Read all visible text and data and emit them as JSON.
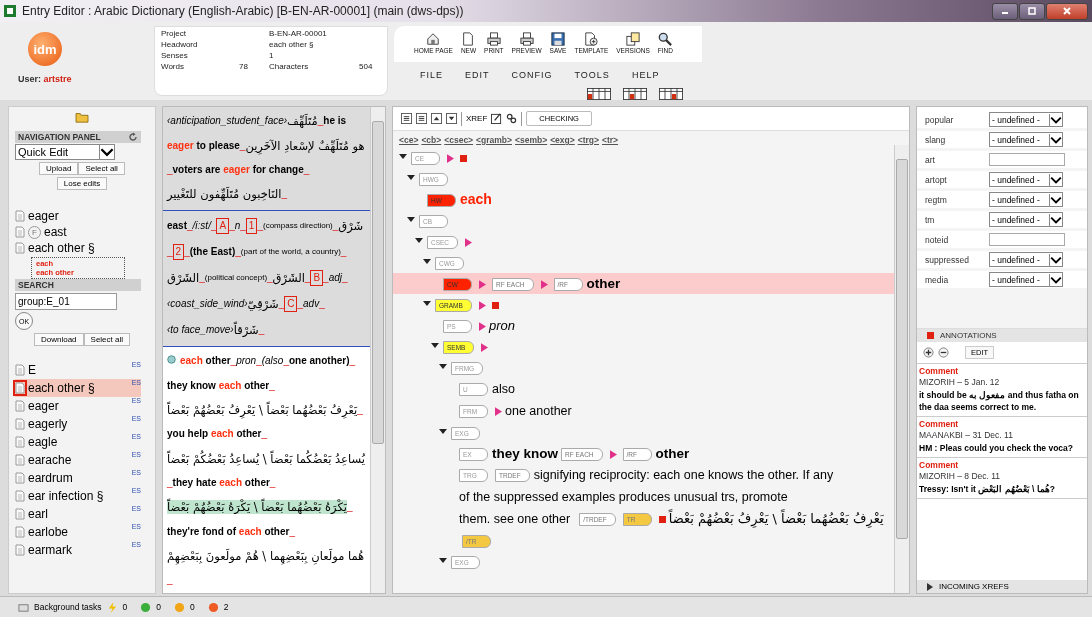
{
  "window": {
    "title": "Entry Editor : Arabic Dictionary (English-Arabic) [B-EN-AR-00001] (main (dws-dps))"
  },
  "header": {
    "logo": "idm",
    "user_label": "User:",
    "user": "artstre",
    "info": [
      {
        "label": "Project",
        "value": "B-EN-AR-00001"
      },
      {
        "label": "Headword",
        "value": "each other §"
      },
      {
        "label": "Senses",
        "value": "1"
      }
    ],
    "words_label": "Words",
    "words": "78",
    "chars_label": "Characters",
    "chars": "504"
  },
  "toolbar": [
    {
      "kind": "home",
      "label": "HOME PAGE"
    },
    {
      "kind": "new",
      "label": "NEW"
    },
    {
      "kind": "print",
      "label": "PRINT"
    },
    {
      "kind": "preview",
      "label": "PREVIEW"
    },
    {
      "kind": "save",
      "label": "SAVE"
    },
    {
      "kind": "template",
      "label": "TEMPLATE"
    },
    {
      "kind": "versions",
      "label": "VERSIONS"
    },
    {
      "kind": "find",
      "label": "FIND"
    }
  ],
  "menu": [
    "FILE",
    "EDIT",
    "CONFIG",
    "TOOLS",
    "HELP"
  ],
  "nav": {
    "title": "NAVIGATION PANEL",
    "mode": "Quick Edit",
    "buttons": [
      "Upload",
      "Select all"
    ],
    "lose": "Lose edits",
    "entries": [
      {
        "kind": "doc",
        "label": "eager"
      },
      {
        "kind": "flag",
        "badge": "F",
        "label": "east"
      },
      {
        "kind": "doc",
        "label": "each other §",
        "senses": [
          "each",
          "each other"
        ]
      }
    ]
  },
  "search": {
    "title": "SEARCH",
    "value": "group:E_01",
    "ok": "OK",
    "buttons": [
      "Download",
      "Select all"
    ],
    "results": [
      {
        "label": "E",
        "tag": "ES",
        "selected": false
      },
      {
        "label": "each other §",
        "tag": "ES",
        "selected": true
      },
      {
        "label": "eager",
        "tag": "ES",
        "selected": false
      },
      {
        "label": "eagerly",
        "tag": "ES",
        "selected": false
      },
      {
        "label": "eagle",
        "tag": "ES",
        "selected": false
      },
      {
        "label": "earache",
        "tag": "ES",
        "selected": false
      },
      {
        "label": "eardrum",
        "tag": "ES",
        "selected": false
      },
      {
        "label": "ear infection §",
        "tag": "ES",
        "selected": false
      },
      {
        "label": "earl",
        "tag": "ES",
        "selected": false
      },
      {
        "label": "earlobe",
        "tag": "ES",
        "selected": false
      },
      {
        "label": "earmark",
        "tag": "ES",
        "selected": false
      }
    ]
  },
  "preview": [
    {
      "selected": false,
      "segments": [
        {
          "kind": "it",
          "text": "‹anticipation_student_face›"
        },
        {
          "kind": "ar",
          "text": "مُتَلَهِّف"
        },
        {
          "kind": "sep",
          "text": "_"
        },
        {
          "kind": "b",
          "text": "he is "
        },
        {
          "kind": "hl",
          "text": "eager"
        },
        {
          "kind": "b",
          "text": " to please"
        },
        {
          "kind": "sep",
          "text": "_"
        },
        {
          "kind": "ar",
          "text": "هو مُتَلَهِّفٌ لإسْعادِ الآخَرِين"
        },
        {
          "kind": "sep",
          "text": "_"
        },
        {
          "kind": "b",
          "text": "voters are "
        },
        {
          "kind": "hl",
          "text": "eager"
        },
        {
          "kind": "b",
          "text": " for change"
        },
        {
          "kind": "sep",
          "text": "_"
        },
        {
          "kind": "ar",
          "text": "النَاخِبون مُتَلَهِّفون للتَغْيير"
        },
        {
          "kind": "sep",
          "text": "_"
        }
      ]
    },
    {
      "selected": false,
      "segments": [
        {
          "kind": "b",
          "text": "east"
        },
        {
          "kind": "sep",
          "text": "_"
        },
        {
          "kind": "it",
          "text": "/iːst/"
        },
        {
          "kind": "sep",
          "text": "_"
        },
        {
          "kind": "box",
          "text": "A"
        },
        {
          "kind": "sep",
          "text": "_"
        },
        {
          "kind": "it",
          "text": "n"
        },
        {
          "kind": "sep",
          "text": "_"
        },
        {
          "kind": "box",
          "text": "1"
        },
        {
          "kind": "sep",
          "text": "_"
        },
        {
          "kind": "sm",
          "text": "(compass direction)"
        },
        {
          "kind": "sep",
          "text": "_"
        },
        {
          "kind": "ar",
          "text": "شَرْق"
        },
        {
          "kind": "sep",
          "text": "_"
        },
        {
          "kind": "box",
          "text": "2"
        },
        {
          "kind": "sep",
          "text": "_"
        },
        {
          "kind": "b",
          "text": "(the East)"
        },
        {
          "kind": "sep",
          "text": "_"
        },
        {
          "kind": "sm",
          "text": "(part of the world, a country)"
        },
        {
          "kind": "sep",
          "text": "_"
        },
        {
          "kind": "ar",
          "text": "الشَرْق"
        },
        {
          "kind": "sep",
          "text": "_"
        },
        {
          "kind": "sm",
          "text": "(political concept)"
        },
        {
          "kind": "sep",
          "text": "_"
        },
        {
          "kind": "ar",
          "text": "الشَرْق"
        },
        {
          "kind": "sep",
          "text": "_"
        },
        {
          "kind": "box",
          "text": "B"
        },
        {
          "kind": "sep",
          "text": "_"
        },
        {
          "kind": "it",
          "text": "adj"
        },
        {
          "kind": "sep",
          "text": "_"
        },
        {
          "kind": "it",
          "text": "‹coast_side_wind›"
        },
        {
          "kind": "ar",
          "text": "شَرْقِيّ"
        },
        {
          "kind": "sep",
          "text": "_"
        },
        {
          "kind": "box",
          "text": "C"
        },
        {
          "kind": "sep",
          "text": "_"
        },
        {
          "kind": "it",
          "text": "adv"
        },
        {
          "kind": "sep",
          "text": "_"
        },
        {
          "kind": "it",
          "text": "‹to face_move›"
        },
        {
          "kind": "ar",
          "text": "شَرْقاً"
        },
        {
          "kind": "sep",
          "text": "_"
        }
      ]
    },
    {
      "selected": true,
      "segments": [
        {
          "kind": "hl",
          "text": "each"
        },
        {
          "kind": "b",
          "text": " other"
        },
        {
          "kind": "sep",
          "text": "_"
        },
        {
          "kind": "it",
          "text": "pron"
        },
        {
          "kind": "sep",
          "text": "_"
        },
        {
          "kind": "it",
          "text": "(also"
        },
        {
          "kind": "sep",
          "text": "_"
        },
        {
          "kind": "b",
          "text": "one another)"
        },
        {
          "kind": "sep",
          "text": "_"
        },
        {
          "kind": "b",
          "text": "they know "
        },
        {
          "kind": "hl",
          "text": "each"
        },
        {
          "kind": "b",
          "text": " other"
        },
        {
          "kind": "sep",
          "text": "_"
        },
        {
          "kind": "ar",
          "text": "يَعْرِفُ بَعْضُهُما بَعْضاً \\ يَعْرِفُ بَعْضُهُمْ بَعْضاً"
        },
        {
          "kind": "sep",
          "text": "_"
        },
        {
          "kind": "b",
          "text": "you help "
        },
        {
          "kind": "hl",
          "text": "each"
        },
        {
          "kind": "b",
          "text": " other"
        },
        {
          "kind": "sep",
          "text": "_"
        },
        {
          "kind": "ar",
          "text": "يُساعِدُ بَعْضُكُما بَعْضاً \\ يُساعِدُ بَعْضُكُمْ بَعْضاً"
        },
        {
          "kind": "sep",
          "text": "_"
        },
        {
          "kind": "b",
          "text": "they hate "
        },
        {
          "kind": "hl",
          "text": "each"
        },
        {
          "kind": "b",
          "text": " other"
        },
        {
          "kind": "sep",
          "text": "_"
        },
        {
          "kind": "arg",
          "text": "يَكْرَهُ بَعْضُهُما بَعْضاً \\ يَكْرَهُ بَعْضُهُمْ بَعْضاً"
        },
        {
          "kind": "sep",
          "text": "_"
        },
        {
          "kind": "b",
          "text": "they're fond of "
        },
        {
          "kind": "hl",
          "text": "each"
        },
        {
          "kind": "b",
          "text": " other"
        },
        {
          "kind": "sep",
          "text": "_"
        },
        {
          "kind": "ar",
          "text": "هُما مولَعانِ بِبَعْضِهِما \\ هُمْ مولَعونَ بِبَعْضِهِمْ"
        },
        {
          "kind": "sep",
          "text": "_"
        }
      ]
    }
  ],
  "tree": {
    "tools": [
      {
        "kind": "indent"
      },
      {
        "kind": "outdent"
      },
      {
        "kind": "up"
      },
      {
        "kind": "down"
      }
    ],
    "xref": "XREF",
    "checking": "CHECKING",
    "path": [
      "<ce>",
      "<cb>",
      "<csec>",
      "<gramb>",
      "<semb>",
      "<exg>",
      "<trg>",
      "<tr>"
    ],
    "nodes": [
      {
        "tag": "CE",
        "expanded": true,
        "selected": false,
        "parts": [
          {
            "kind": "arrow"
          },
          {
            "kind": "square"
          }
        ],
        "children": [
          {
            "tag": "HWG",
            "expanded": true,
            "selected": false,
            "children": [
              {
                "tag": "HW",
                "color": "#ff2200",
                "selected": false,
                "parts": [
                  {
                    "kind": "head",
                    "text": "each"
                  }
                ]
              }
            ]
          },
          {
            "tag": "CB",
            "expanded": true,
            "selected": false,
            "children": [
              {
                "tag": "CSEC",
                "expanded": true,
                "selected": false,
                "parts": [
                  {
                    "kind": "arrow"
                  }
                ],
                "children": [
                  {
                    "tag": "CWG",
                    "expanded": true,
                    "selected": false,
                    "children": [
                      {
                        "tag": "CW",
                        "color": "#ff2200",
                        "selected": true,
                        "parts": [
                          {
                            "kind": "arrow"
                          },
                          {
                            "kind": "tag",
                            "text": "RF EACH"
                          },
                          {
                            "kind": "arrow"
                          },
                          {
                            "kind": "tag",
                            "text": "/RF"
                          },
                          {
                            "kind": "bold",
                            "text": "other"
                          }
                        ]
                      }
                    ]
                  },
                  {
                    "tag": "GRAMB",
                    "color": "#ffff33",
                    "expanded": true,
                    "selected": false,
                    "parts": [
                      {
                        "kind": "arrow"
                      },
                      {
                        "kind": "square"
                      }
                    ],
                    "children": [
                      {
                        "tag": "PS",
                        "selected": false,
                        "parts": [
                          {
                            "kind": "arrow"
                          },
                          {
                            "kind": "italic",
                            "text": "pron"
                          }
                        ]
                      },
                      {
                        "tag": "SEMB",
                        "color": "#ffff33",
                        "expanded": true,
                        "selected": false,
                        "parts": [
                          {
                            "kind": "arrow"
                          }
                        ],
                        "children": [
                          {
                            "tag": "FRMG",
                            "expanded": true,
                            "selected": false,
                            "children": [
                              {
                                "tag": "U",
                                "selected": false,
                                "parts": [
                                  {
                                    "kind": "word",
                                    "text": "also"
                                  }
                                ]
                              },
                              {
                                "tag": "FRM",
                                "selected": false,
                                "parts": [
                                  {
                                    "kind": "arrow"
                                  },
                                  {
                                    "kind": "word",
                                    "text": "one another"
                                  }
                                ]
                              }
                            ]
                          },
                          {
                            "tag": "EXG",
                            "expanded": true,
                            "selected": false,
                            "children": [
                              {
                                "tag": "EX",
                                "selected": false,
                                "parts": [
                                  {
                                    "kind": "bold",
                                    "text": "they know"
                                  },
                                  {
                                    "kind": "tag",
                                    "text": "RF EACH"
                                  },
                                  {
                                    "kind": "arrow"
                                  },
                                  {
                                    "kind": "tag",
                                    "text": "/RF"
                                  },
                                  {
                                    "kind": "bold",
                                    "text": "other"
                                  }
                                ]
                              },
                              {
                                "tag": "TRG",
                                "selected": false,
                                "parts": [
                                  {
                                    "kind": "tag",
                                    "text": "TRDEF"
                                  },
                                  {
                                    "kind": "word",
                                    "text": "signifying reciprocity: each one knows the other. If any"
                                  },
                                  {
                                    "kind": "word",
                                    "text": "of the suppressed examples produces unusual trs, promote"
                                  },
                                  {
                                    "kind": "word",
                                    "text": "them. see one other"
                                  },
                                  {
                                    "kind": "tag",
                                    "text": "/TRDEF"
                                  },
                                  {
                                    "kind": "tag",
                                    "text": "TR",
                                    "color": "#f5c842"
                                  },
                                  {
                                    "kind": "square"
                                  },
                                  {
                                    "kind": "ar",
                                    "text": "يَعْرِفُ بَعْضُهُما بَعْضاً \\ يَعْرِفُ بَعْضُهُمْ بَعْضاً"
                                  },
                                  {
                                    "kind": "tag",
                                    "text": "/TR",
                                    "color": "#f5c842"
                                  }
                                ]
                              }
                            ]
                          },
                          {
                            "tag": "EXG",
                            "expanded": true,
                            "selected": false
                          }
                        ]
                      }
                    ]
                  }
                ]
              }
            ]
          }
        ]
      }
    ]
  },
  "properties": [
    {
      "label": "popular",
      "kind": "select",
      "value": "- undefined -"
    },
    {
      "label": "slang",
      "kind": "select",
      "value": "- undefined -"
    },
    {
      "label": "art",
      "kind": "input"
    },
    {
      "label": "artopt",
      "kind": "select",
      "value": "- undefined -"
    },
    {
      "label": "regtm",
      "kind": "select",
      "value": "- undefined -"
    },
    {
      "label": "tm",
      "kind": "select",
      "value": "- undefined -"
    },
    {
      "label": "noteid",
      "kind": "input"
    },
    {
      "label": "suppressed",
      "kind": "select",
      "value": "- undefined -"
    },
    {
      "label": "media",
      "kind": "select",
      "value": "- undefined -"
    }
  ],
  "annotations": {
    "title": "ANNOTATIONS",
    "edit": "EDIT",
    "comments": [
      {
        "title": "Comment",
        "meta": "MIZORIH – 5 Jan. 12",
        "text": "it should be مفعول به and thus fatha on the daa seems correct to me."
      },
      {
        "title": "Comment",
        "meta": "MAANAKBI – 31 Dec. 11",
        "text": "HM : Pleas could you check the voca?"
      },
      {
        "title": "Comment",
        "meta": "MIZORIH – 8 Dec. 11",
        "text": "Tressy: Isn't it هُما \\ بَعْضُهُم البَعْض?"
      }
    ]
  },
  "xrefs": {
    "title": "INCOMING XREFS",
    "expanded": false
  },
  "status": {
    "label": "Background tasks",
    "items": [
      {
        "kind": "bolt",
        "count": "0"
      },
      {
        "kind": "dot",
        "color": "#3cae3c",
        "count": "0"
      },
      {
        "kind": "dot",
        "color": "#f2a516",
        "count": "0"
      },
      {
        "kind": "dot",
        "color": "#ee5a24",
        "count": "2"
      }
    ]
  }
}
